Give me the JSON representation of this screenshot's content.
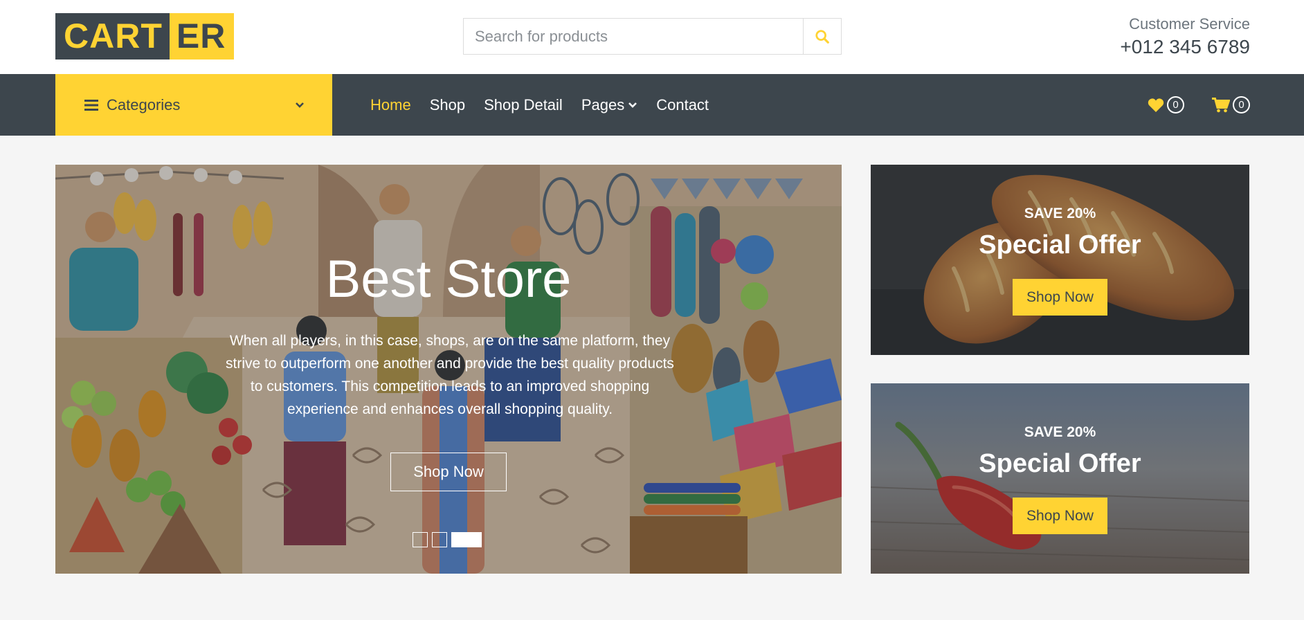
{
  "brand": {
    "part1": "CART",
    "part2": "ER"
  },
  "search": {
    "placeholder": "Search for products",
    "icon": "search-icon"
  },
  "customer_service": {
    "label": "Customer Service",
    "phone": "+012 345 6789"
  },
  "categories": {
    "label": "Categories",
    "icon": "bars-icon"
  },
  "menu": [
    {
      "label": "Home",
      "active": true
    },
    {
      "label": "Shop"
    },
    {
      "label": "Shop Detail"
    },
    {
      "label": "Pages",
      "dropdown": true
    },
    {
      "label": "Contact"
    }
  ],
  "wishlist": {
    "icon": "heart-icon",
    "count": "0"
  },
  "cart": {
    "icon": "shopping-cart-icon",
    "count": "0"
  },
  "hero": {
    "title": "Best Store",
    "text": "When all players, in this case, shops, are on the same platform, they strive to outperform one another and provide the best quality products to customers. This competition leads to an improved shopping experience and enhances overall shopping quality.",
    "button": "Shop Now",
    "slides": 3,
    "active_slide": 3
  },
  "offers": [
    {
      "save": "SAVE 20%",
      "title": "Special Offer",
      "button": "Shop Now",
      "image": "bread loaves"
    },
    {
      "save": "SAVE 20%",
      "title": "Special Offer",
      "button": "Shop Now",
      "image": "red chili pepper"
    }
  ],
  "colors": {
    "primary": "#ffd333",
    "dark": "#3d464d",
    "light": "#f5f5f5"
  }
}
